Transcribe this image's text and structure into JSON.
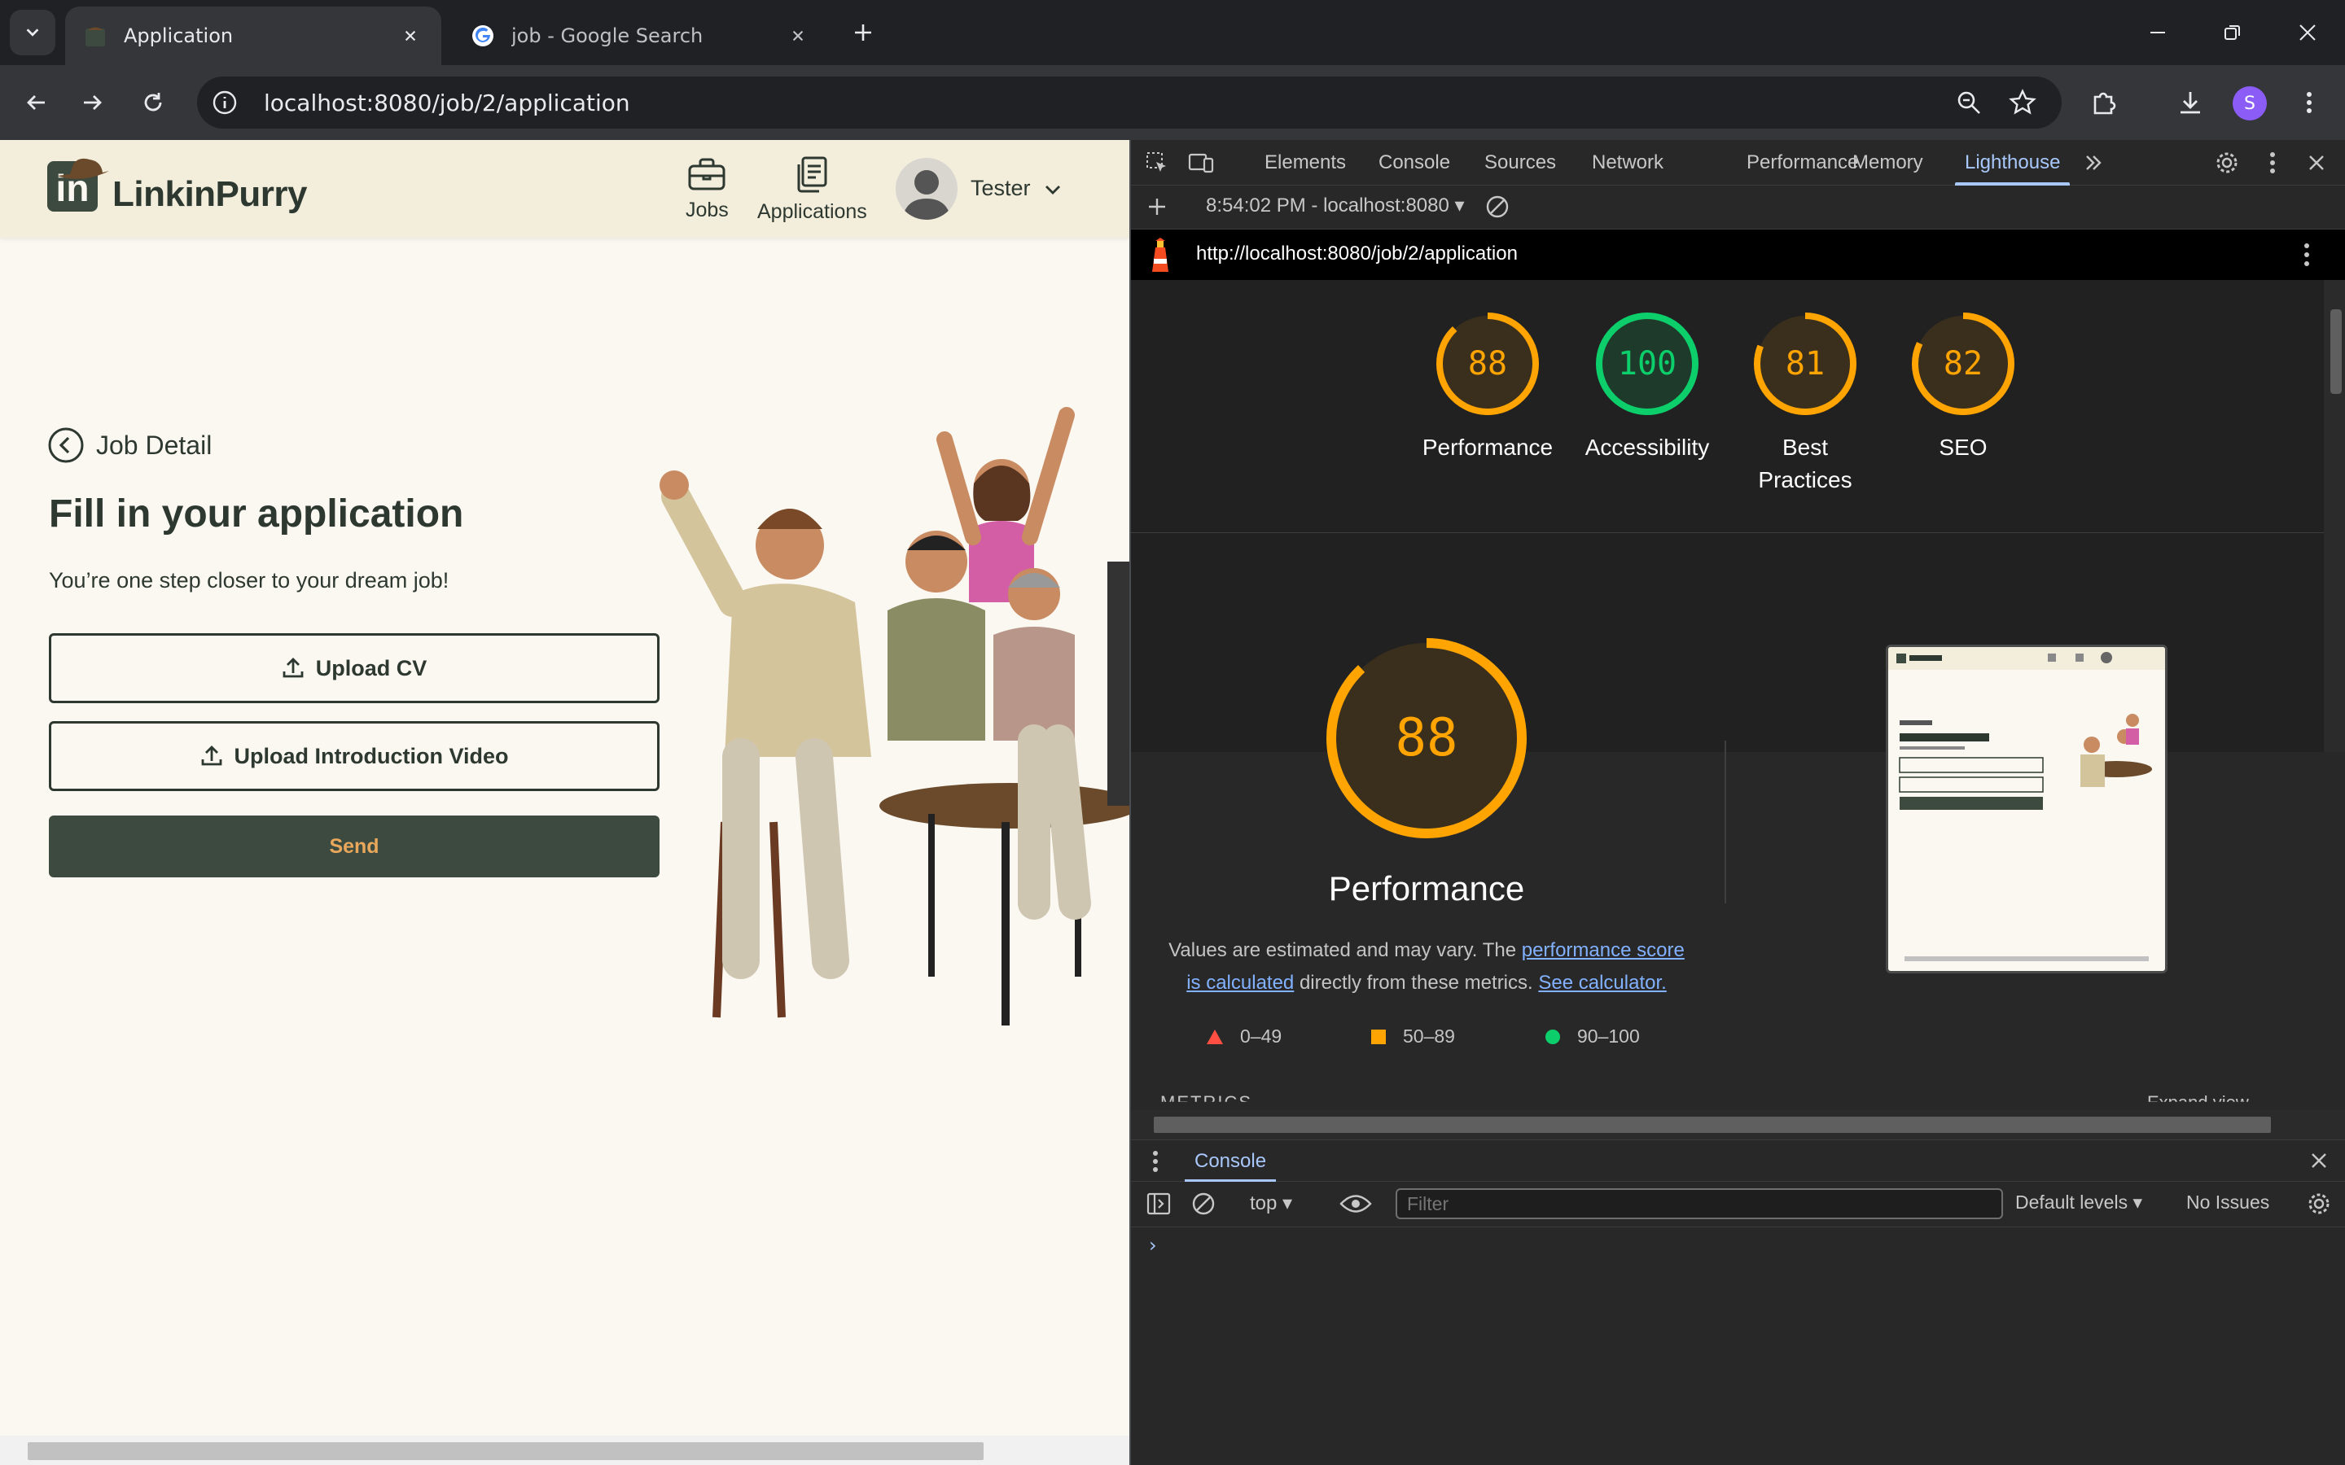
{
  "browser": {
    "tabs": [
      {
        "title": "Application",
        "active": true
      },
      {
        "title": "job - Google Search",
        "active": false
      }
    ],
    "url": "localhost:8080/job/2/application",
    "profile_initial": "S"
  },
  "site": {
    "brand": "LinkinPurry",
    "nav": {
      "jobs": "Jobs",
      "applications": "Applications"
    },
    "user": "Tester",
    "back_link": "Job Detail",
    "title": "Fill in your application",
    "subtitle": "You’re one step closer to your dream job!",
    "upload_cv": "Upload CV",
    "upload_video": "Upload Introduction Video",
    "send": "Send"
  },
  "devtools": {
    "tabs": [
      "Elements",
      "Console",
      "Sources",
      "Network",
      "Performance",
      "Memory",
      "Lighthouse"
    ],
    "selected_tab": "Lighthouse",
    "report_selector": "8:54:02 PM - localhost:8080",
    "report_url": "http://localhost:8080/job/2/application",
    "scores": [
      {
        "name": "Performance",
        "score": 88
      },
      {
        "name": "Accessibility",
        "score": 100
      },
      {
        "name": "Best Practices",
        "score": 81
      },
      {
        "name": "SEO",
        "score": 82
      }
    ],
    "detail": {
      "score": 88,
      "title": "Performance",
      "desc_prefix": "Values are estimated and may vary. The ",
      "desc_link1": "performance score is calculated",
      "desc_middle": " directly from these metrics. ",
      "desc_link2": "See calculator."
    },
    "legend": {
      "fail": "0–49",
      "average": "50–89",
      "pass": "90–100"
    },
    "metrics_peek": "METRICS",
    "expand_peek": "Expand view",
    "drawer_tab": "Console",
    "console": {
      "context": "top",
      "filter_placeholder": "Filter",
      "levels": "Default levels",
      "issues": "No Issues"
    }
  },
  "colors": {
    "pass": "#0cce6b",
    "average": "#ffa400",
    "fail": "#ff4e42",
    "brand_dark": "#3d4a40",
    "page_bg": "#fbf8f1"
  }
}
